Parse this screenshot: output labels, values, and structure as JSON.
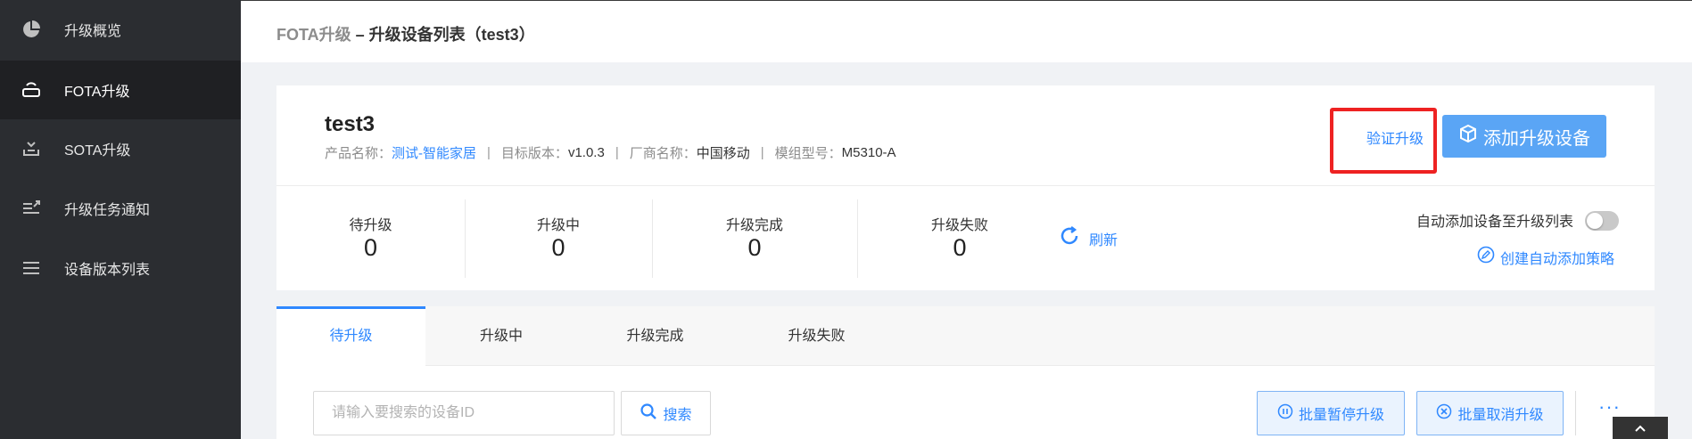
{
  "sidebar": {
    "items": [
      {
        "label": "升级概览",
        "icon": "pie-chart-icon"
      },
      {
        "label": "FOTA升级",
        "icon": "router-icon"
      },
      {
        "label": "SOTA升级",
        "icon": "download-tray-icon"
      },
      {
        "label": "升级任务通知",
        "icon": "notify-list-icon"
      },
      {
        "label": "设备版本列表",
        "icon": "list-icon"
      }
    ]
  },
  "header": {
    "breadcrumb_prefix": "FOTA升级",
    "breadcrumb_rest": " – 升级设备列表（test3）"
  },
  "product": {
    "title": "test3",
    "name_label": "产品名称：",
    "name_value": "测试-智能家居",
    "version_label": "目标版本：",
    "version_value": "v1.0.3",
    "vendor_label": "厂商名称：",
    "vendor_value": "中国移动",
    "module_label": "模组型号：",
    "module_value": "M5310-A",
    "separator": "|"
  },
  "actions": {
    "verify_label": "验证升级",
    "add_device_label": "添加升级设备"
  },
  "stats": [
    {
      "label": "待升级",
      "value": "0"
    },
    {
      "label": "升级中",
      "value": "0"
    },
    {
      "label": "升级完成",
      "value": "0"
    },
    {
      "label": "升级失败",
      "value": "0"
    }
  ],
  "refresh_label": "刷新",
  "auto_add": {
    "label": "自动添加设备至升级列表",
    "enabled": false,
    "policy_label": "创建自动添加策略"
  },
  "tabs": [
    {
      "label": "待升级",
      "active": true
    },
    {
      "label": "升级中",
      "active": false
    },
    {
      "label": "升级完成",
      "active": false
    },
    {
      "label": "升级失败",
      "active": false
    }
  ],
  "toolbar": {
    "search_placeholder": "请输入要搜索的设备ID",
    "search_label": "搜索",
    "batch_pause_label": "批量暂停升级",
    "batch_cancel_label": "批量取消升级",
    "more_label": "···"
  },
  "colors": {
    "accent": "#2f88ff",
    "sidebar_bg": "#2b2d31",
    "highlight_border": "#ee2222"
  }
}
